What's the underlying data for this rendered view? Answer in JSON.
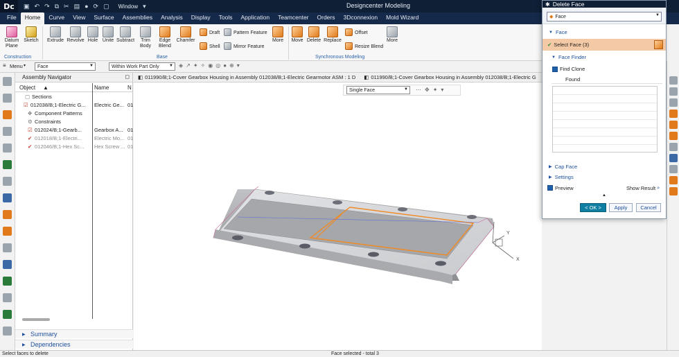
{
  "app": {
    "logo": "Dc",
    "title": "Designcenter Modeling",
    "window_label": "Window"
  },
  "menu": [
    "File",
    "Home",
    "Curve",
    "View",
    "Surface",
    "Assemblies",
    "Analysis",
    "Display",
    "Tools",
    "Application",
    "Teamcenter",
    "Orders",
    "3Dconnexion",
    "Mold Wizard"
  ],
  "menu_active": "Home",
  "ribbon": {
    "big": [
      {
        "id": "datum-plane",
        "label": "Datum\nPlane"
      },
      {
        "id": "sketch",
        "label": "Sketch"
      },
      {
        "id": "extrude",
        "label": "Extrude"
      },
      {
        "id": "revolve",
        "label": "Revolve"
      },
      {
        "id": "hole",
        "label": "Hole"
      },
      {
        "id": "unite",
        "label": "Unite"
      },
      {
        "id": "subtract",
        "label": "Subtract"
      },
      {
        "id": "trim-body",
        "label": "Trim\nBody"
      },
      {
        "id": "edge-blend",
        "label": "Edge\nBlend"
      },
      {
        "id": "chamfer",
        "label": "Chamfer"
      },
      {
        "id": "more1",
        "label": "More"
      },
      {
        "id": "move",
        "label": "Move"
      },
      {
        "id": "delete",
        "label": "Delete"
      },
      {
        "id": "replace",
        "label": "Replace"
      },
      {
        "id": "more2",
        "label": "More"
      }
    ],
    "small": [
      {
        "id": "draft",
        "label": "Draft"
      },
      {
        "id": "shell",
        "label": "Shell"
      },
      {
        "id": "pattern-feature",
        "label": "Pattern Feature"
      },
      {
        "id": "mirror-feature",
        "label": "Mirror Feature"
      },
      {
        "id": "offset",
        "label": "Offset"
      },
      {
        "id": "resize-blend",
        "label": "Resize Blend"
      }
    ],
    "groups": {
      "construction": "Construction",
      "base": "Base",
      "sync": "Synchronous Modeling"
    }
  },
  "selection": {
    "menu": "Menu",
    "filter": "Face",
    "scope": "Within Work Part Only"
  },
  "navigator": {
    "title": "Assembly Navigator",
    "col_object": "Object",
    "col_name": "Name",
    "col_n": "N",
    "rows": [
      {
        "obj": "Sections",
        "name": "",
        "n": ""
      },
      {
        "obj": "012038/B;1-Electric G...",
        "name": "Electric Ge...",
        "n": "01"
      },
      {
        "obj": "Component Patterns",
        "name": "",
        "n": ""
      },
      {
        "obj": "Constraints",
        "name": "",
        "n": ""
      },
      {
        "obj": "012024/B;1-Gearb...",
        "name": "Gearbox A...",
        "n": "01"
      },
      {
        "obj": "012018/B;1-Electri...",
        "name": "Electric Mo...",
        "n": "01"
      },
      {
        "obj": "012046/B;1-Hex Sc...",
        "name": "Hex Screw ...",
        "n": "01"
      }
    ],
    "summary": "Summary",
    "dependencies": "Dependencies"
  },
  "tabs": [
    "011990/B;1-Cover Gearbox Housing in Assembly 012038/B;1-Electric Gearmotor ASM : 1 D",
    "011990/B;1-Cover Gearbox Housing in Assembly 012038/B;1-Electric G"
  ],
  "viewport": {
    "face_rule": "Single Face",
    "axis_x": "X",
    "axis_y": "Y"
  },
  "dialog": {
    "title": "Delete Face",
    "type_value": "Face",
    "sec_face": "Face",
    "select_face": "Select Face (3)",
    "face_finder": "Face Finder",
    "find_clone": "Find Clone",
    "found": "Found",
    "cap_face": "Cap Face",
    "settings": "Settings",
    "preview": "Preview",
    "show_result": "Show Result",
    "ok": "< OK >",
    "apply": "Apply",
    "cancel": "Cancel"
  },
  "status": {
    "left": "Select faces to delete",
    "center": "Face selected - total 3"
  }
}
